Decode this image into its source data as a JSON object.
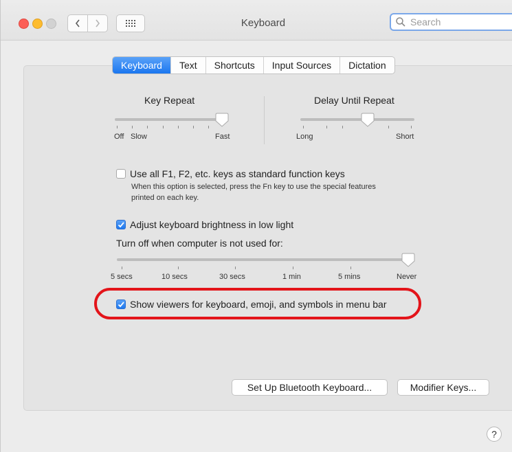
{
  "window": {
    "title": "Keyboard"
  },
  "search": {
    "placeholder": "Search"
  },
  "icons": {
    "back": "chevron-left-icon",
    "forward": "chevron-right-icon",
    "show_all": "grid-icon",
    "search": "magnifier-icon",
    "help": "question-icon"
  },
  "tabs": [
    {
      "label": "Keyboard",
      "active": true
    },
    {
      "label": "Text"
    },
    {
      "label": "Shortcuts"
    },
    {
      "label": "Input Sources"
    },
    {
      "label": "Dictation"
    }
  ],
  "key_repeat": {
    "title": "Key Repeat",
    "labels": [
      "Off",
      "Slow",
      "Fast"
    ]
  },
  "delay_until_repeat": {
    "title": "Delay Until Repeat",
    "labels": [
      "Long",
      "Short"
    ]
  },
  "function_keys": {
    "label": "Use all F1, F2, etc. keys as standard function keys",
    "description_line1": "When this option is selected, press the Fn key to use the special features",
    "description_line2": "printed on each key.",
    "checked": false
  },
  "brightness": {
    "label": "Adjust keyboard brightness in low light",
    "checked": true
  },
  "turn_off": {
    "label": "Turn off when computer is not used for:",
    "labels": [
      "5 secs",
      "10 secs",
      "30 secs",
      "1 min",
      "5 mins",
      "Never"
    ]
  },
  "viewers": {
    "label": "Show viewers for keyboard, emoji, and symbols in menu bar",
    "checked": true
  },
  "buttons": {
    "bluetooth": "Set Up Bluetooth Keyboard...",
    "modifier": "Modifier Keys..."
  },
  "help": {
    "label": "?"
  },
  "colors": {
    "accent": "#1f78ee",
    "highlight": "#e3141a"
  }
}
